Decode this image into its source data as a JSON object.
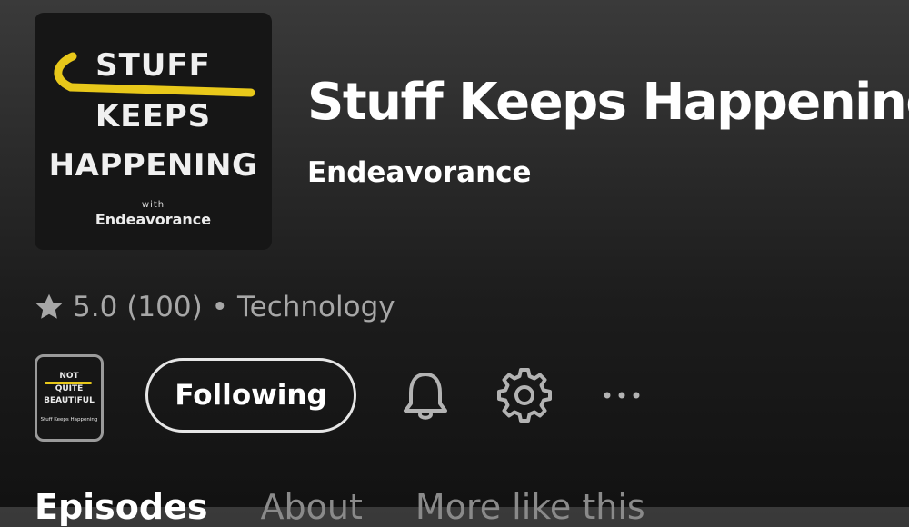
{
  "podcast": {
    "title": "Stuff Keeps Happening",
    "host": "Endeavorance",
    "cover": {
      "line1": "STUFF",
      "line2": "KEEPS",
      "line3": "HAPPENING",
      "with": "with",
      "host": "Endeavorance",
      "accent_color": "#e8c81a"
    }
  },
  "meta": {
    "rating": "5.0",
    "review_count": "(100)",
    "separator": "•",
    "category": "Technology",
    "star_icon": "star-icon"
  },
  "related_show": {
    "line1": "NOT",
    "line2": "QUITE",
    "line3": "BEAUTIFUL",
    "line4": "Stuff Keeps Happening"
  },
  "actions": {
    "follow_label": "Following",
    "bell_icon": "bell-icon",
    "gear_icon": "gear-icon",
    "more_icon": "more-icon"
  },
  "tabs": [
    {
      "label": "Episodes",
      "active": true
    },
    {
      "label": "About",
      "active": false
    },
    {
      "label": "More like this",
      "active": false
    }
  ],
  "colors": {
    "text_primary": "#ffffff",
    "text_secondary": "#a7a7a7",
    "accent_yellow": "#e8c81a"
  }
}
